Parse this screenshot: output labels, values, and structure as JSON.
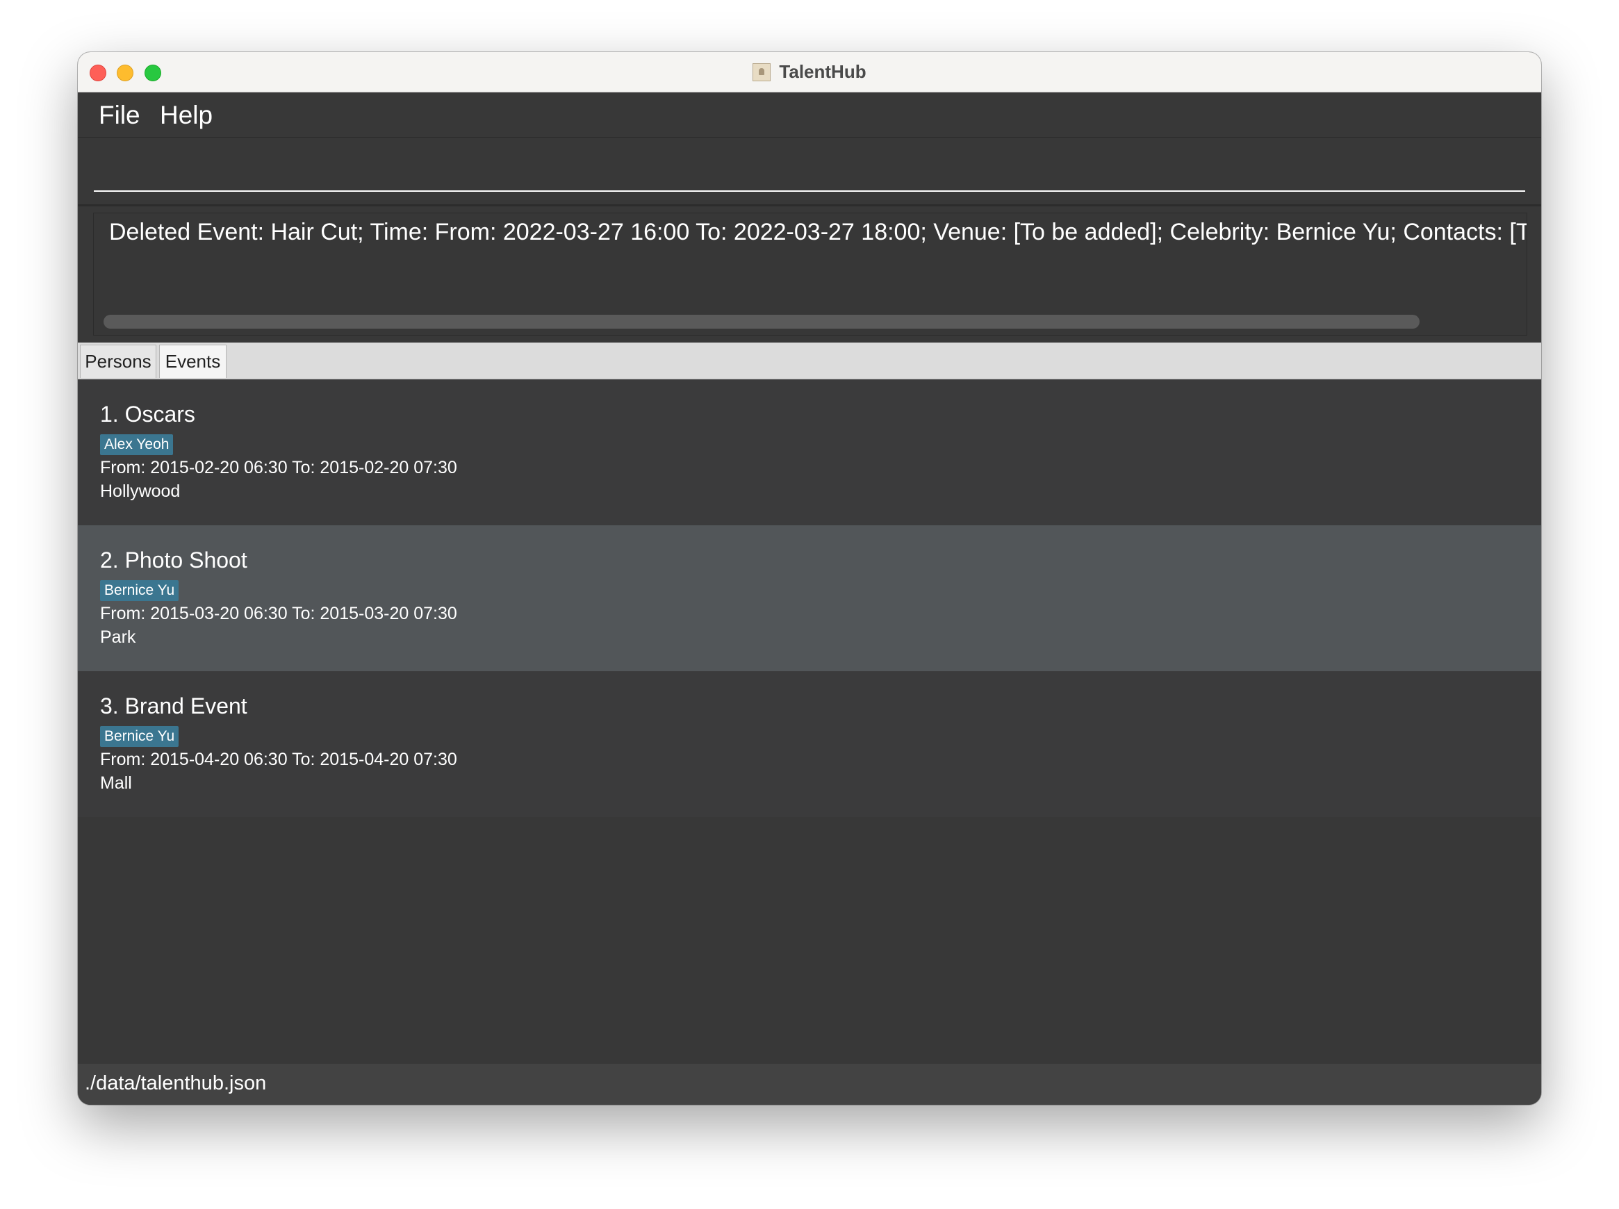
{
  "window": {
    "title": "TalentHub"
  },
  "menu": {
    "file": "File",
    "help": "Help"
  },
  "command": {
    "value": ""
  },
  "result": {
    "text": "Deleted Event: Hair Cut; Time: From: 2022-03-27 16:00 To: 2022-03-27 18:00; Venue: [To be added]; Celebrity: Bernice Yu; Contacts: [To be added]"
  },
  "tabs": {
    "persons": "Persons",
    "events": "Events",
    "active": "Events"
  },
  "events": [
    {
      "title": "1. Oscars",
      "tag": "Alex Yeoh",
      "time": "From: 2015-02-20 06:30 To: 2015-02-20 07:30",
      "venue": "Hollywood"
    },
    {
      "title": "2. Photo Shoot",
      "tag": "Bernice Yu",
      "time": "From: 2015-03-20 06:30 To: 2015-03-20 07:30",
      "venue": "Park"
    },
    {
      "title": "3. Brand Event",
      "tag": "Bernice Yu",
      "time": "From: 2015-04-20 06:30 To: 2015-04-20 07:30",
      "venue": "Mall"
    }
  ],
  "selected_event": "2. Photo Shoot",
  "status": {
    "path": "./data/talenthub.json"
  },
  "colors": {
    "background": "#383838",
    "selected_card": "#525659",
    "tag": "#3b7690",
    "statusbar": "#434343"
  },
  "icons": {
    "app": "contacts-app-icon"
  }
}
